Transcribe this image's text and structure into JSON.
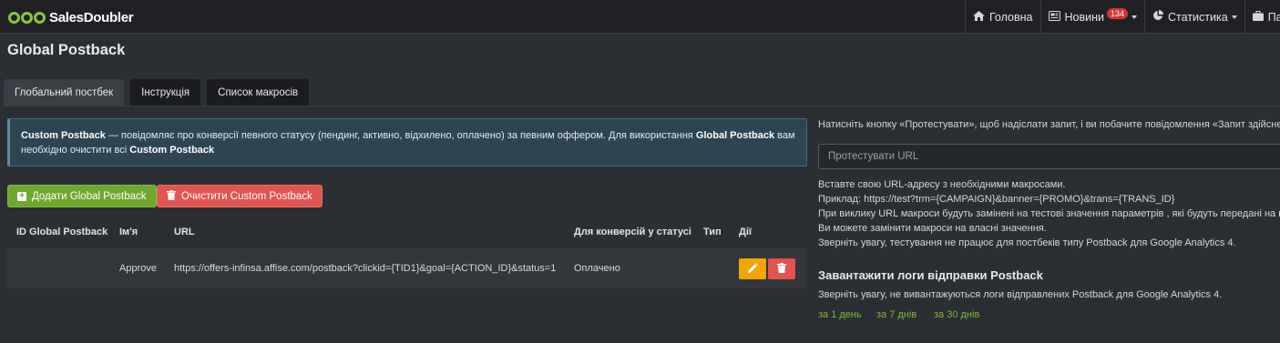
{
  "brand": {
    "part1": "Sales",
    "part2": "Doubler"
  },
  "nav": {
    "home": "Головна",
    "news": "Новини",
    "news_badge": "134",
    "stats": "Статистика",
    "partners": "Партн"
  },
  "page_title": "Global Postback",
  "tabs": [
    "Глобальний постбек",
    "Інструкція",
    "Список макросів"
  ],
  "info": {
    "b1": "Custom Postback",
    "t1": " — повідомляє про конверсії певного статусу (пендинг, активно, відхилено, оплачено) за певним оффером.  Для використання ",
    "b2": "Global Postback",
    "t2": " вам",
    "t3": "необхідно очистити всі ",
    "b3": "Custom Postback"
  },
  "buttons": {
    "add": "Додати Global Postback",
    "clear": "Очистити Custom Postback"
  },
  "table": {
    "headers": [
      "ID Global Postback",
      "Ім'я",
      "URL",
      "Для конверсій у статусі",
      "Тип",
      "Дії"
    ],
    "rows": [
      {
        "id": "",
        "name": "Approve",
        "url": "https://offers-infinsa.affise.com/postback?clickid={TID1}&goal={ACTION_ID}&status=1",
        "status": "Оплачено",
        "type": ""
      }
    ]
  },
  "right": {
    "intro": "Натисніть кнопку «Протестувати», щоб надіслати запит, і ви побачите повідомлення «Запит здійснено»",
    "input_placeholder": "Протестувати URL",
    "lines": [
      "Вставте свою URL-адресу з необхідними макросами.",
      "Приклад: https://test?trm={CAMPAIGN}&banner={PROMO}&trans={TRANS_ID}",
      "При виклику URL макроси будуть замінені на тестові значення параметрів , які будуть передані на ваш",
      "Ви можете замінити макроси на власні значення.",
      "Зверніть увагу, тестування не працює для постбеків типу Postback для Google Analytics 4."
    ],
    "logs_title": "Завантажити логи відправки Postback",
    "logs_note": "Зверніть увагу, не вивантажуються логи відправлених Postback для Google Analytics 4.",
    "links": [
      "за 1 день",
      "за 7 днів",
      "за 30 днів"
    ]
  },
  "colors": {
    "accent_green": "#8cc63f",
    "btn_green": "#6fa82f",
    "btn_red": "#e2544f",
    "btn_orange": "#f0a500"
  }
}
